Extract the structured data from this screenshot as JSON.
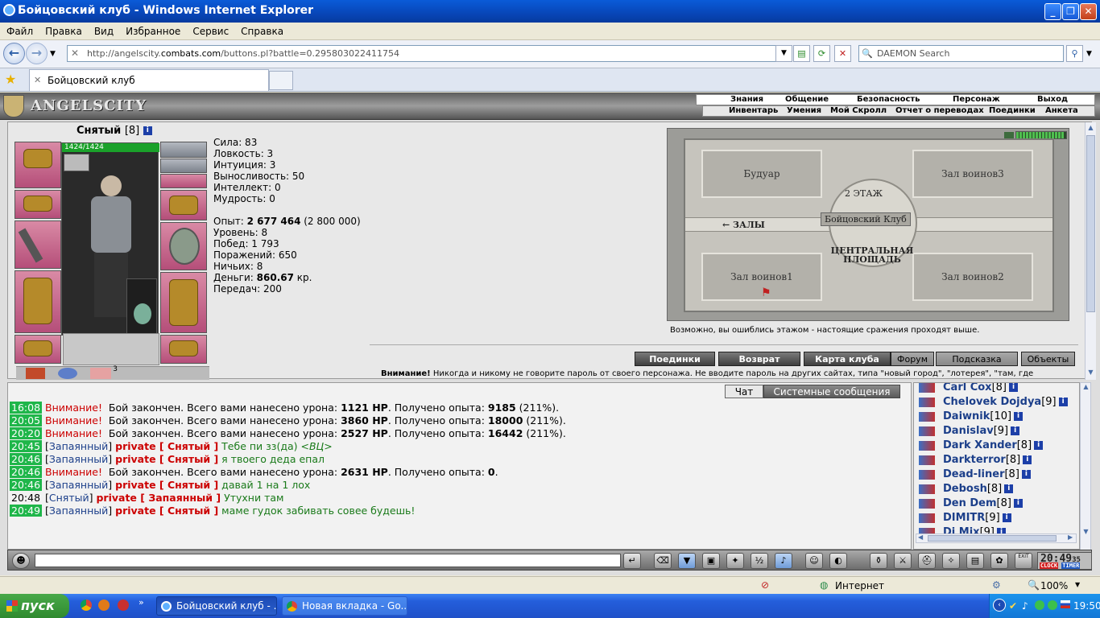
{
  "window": {
    "title": "Бойцовский клуб - Windows Internet Explorer"
  },
  "menu": [
    "Файл",
    "Правка",
    "Вид",
    "Избранное",
    "Сервис",
    "Справка"
  ],
  "address": {
    "url_prefix": "http://angelscity.",
    "url_site": "combats.com",
    "url_suffix": "/buttons.pl?battle=0.295803022411754",
    "search_placeholder": "DAEMON Search"
  },
  "tab": {
    "title": "Бойцовский клуб"
  },
  "game": {
    "logo": "ANGELSCITY",
    "top_menu": [
      "Знания",
      "Общение",
      "Безопасность",
      "Персонаж",
      "Выход"
    ],
    "sub_menu": [
      "Инвентарь",
      "Умения",
      "Мой Скролл",
      "Отчет о переводах",
      "Поединки",
      "Анкета"
    ],
    "character": {
      "name": "Снятый",
      "level": "[8]",
      "hp": "1424/1424",
      "pet_count": "3"
    },
    "stats": {
      "strength": "Сила: 83",
      "agility": "Ловкость: 3",
      "intuition": "Интуиция: 3",
      "endurance": "Выносливость: 50",
      "intellect": "Интеллект: 0",
      "wisdom": "Мудрость: 0",
      "exp_label": "Опыт: ",
      "exp_value": "2 677 464",
      "exp_next": " (2 800 000)",
      "level": "Уровень: 8",
      "wins": "Побед: 1 793",
      "losses": "Поражений: 650",
      "draws": "Ничьих: 8",
      "money_label": "Деньги: ",
      "money_value": "860.67",
      "money_unit": " кр.",
      "transfers": "Передач: 200"
    },
    "map": {
      "room_tl": "Будуар",
      "room_tr": "Зал воинов3",
      "room_bl": "Зал воинов1",
      "room_br": "Зал воинов2",
      "floor": "2 ЭТАЖ",
      "center": "Бойцовский Клуб",
      "halls": "← ЗАЛЫ",
      "plaza": "ЦЕНТРАЛЬНАЯ ПЛОЩАДЬ"
    },
    "map_note": "Возможно, вы ошиблись этажом - настоящие сражения проходят выше.",
    "nav_buttons": [
      "Поединки",
      "Возврат",
      "Карта клуба",
      "Форум",
      "Подсказка",
      "Объекты"
    ],
    "warning_bold": "Внимание!",
    "warning_text": " Никогда и никому не говорите пароль от своего персонажа. Не вводите пароль на других сайтах, типа \"новый город\", \"лотерея\", \"там, где",
    "chat_tabs": [
      "Чат",
      "Системные сообщения"
    ],
    "messages": [
      {
        "time": "16:08",
        "parts": [
          [
            "wn",
            "Внимание!"
          ],
          [
            "",
            "  Бой закончен. Всего вами нанесено урона: "
          ],
          [
            "b",
            "1121 HP"
          ],
          [
            "",
            ". Получено опыта: "
          ],
          [
            "b",
            "9185"
          ],
          [
            "",
            " (211%)."
          ]
        ]
      },
      {
        "time": "20:05",
        "parts": [
          [
            "wn",
            "Внимание!"
          ],
          [
            "",
            "  Бой закончен. Всего вами нанесено урона: "
          ],
          [
            "b",
            "3860 HP"
          ],
          [
            "",
            ". Получено опыта: "
          ],
          [
            "b",
            "18000"
          ],
          [
            "",
            " (211%)."
          ]
        ]
      },
      {
        "time": "20:20",
        "parts": [
          [
            "wn",
            "Внимание!"
          ],
          [
            "",
            "  Бой закончен. Всего вами нанесено урона: "
          ],
          [
            "b",
            "2527 HP"
          ],
          [
            "",
            ". Получено опыта: "
          ],
          [
            "b",
            "16442"
          ],
          [
            "",
            " (211%)."
          ]
        ]
      },
      {
        "time": "20:45",
        "parts": [
          [
            "",
            "["
          ],
          [
            "nick",
            "Запаянный"
          ],
          [
            "",
            "] "
          ],
          [
            "priv",
            "private [ Снятый ]"
          ],
          [
            "txt",
            " Тебе пи зз(да) "
          ],
          [
            "txti",
            "<ВЦ>"
          ]
        ]
      },
      {
        "time": "20:46",
        "parts": [
          [
            "",
            "["
          ],
          [
            "nick",
            "Запаянный"
          ],
          [
            "",
            "] "
          ],
          [
            "priv",
            "private [ Снятый ]"
          ],
          [
            "txt",
            " я твоего деда епал"
          ]
        ]
      },
      {
        "time": "20:46",
        "parts": [
          [
            "wn",
            "Внимание!"
          ],
          [
            "",
            "  Бой закончен. Всего вами нанесено урона: "
          ],
          [
            "b",
            "2631 HP"
          ],
          [
            "",
            ". Получено опыта: "
          ],
          [
            "b",
            "0"
          ],
          [
            "",
            "."
          ]
        ]
      },
      {
        "time": "20:46",
        "parts": [
          [
            "",
            "["
          ],
          [
            "nick",
            "Запаянный"
          ],
          [
            "",
            "] "
          ],
          [
            "priv",
            "private [ Снятый ]"
          ],
          [
            "txt",
            " давай 1 на 1 лох"
          ]
        ]
      },
      {
        "time": "20:48",
        "plain": true,
        "parts": [
          [
            "",
            "["
          ],
          [
            "nick",
            "Снятый"
          ],
          [
            "",
            "] "
          ],
          [
            "priv",
            "private [ Запаянный ]"
          ],
          [
            "txt",
            " Утухни там"
          ]
        ]
      },
      {
        "time": "20:49",
        "parts": [
          [
            "",
            "["
          ],
          [
            "nick",
            "Запаянный"
          ],
          [
            "",
            "] "
          ],
          [
            "priv",
            "private [ Снятый ]"
          ],
          [
            "txt",
            " маме гудок забивать совее будешь!"
          ]
        ]
      }
    ],
    "online": [
      {
        "name": "Carl Cox",
        "level": "[8]"
      },
      {
        "name": "Chelovek Dojdya",
        "level": "[9]"
      },
      {
        "name": "Daiwnik",
        "level": "[10]"
      },
      {
        "name": "Danislav",
        "level": "[9]"
      },
      {
        "name": "Dark Xander",
        "level": "[8]"
      },
      {
        "name": "Darkterror",
        "level": "[8]"
      },
      {
        "name": "Dead-liner",
        "level": "[8]"
      },
      {
        "name": "Debosh",
        "level": "[8]"
      },
      {
        "name": "Den Dem",
        "level": "[8]"
      },
      {
        "name": "DIMITR",
        "level": "[9]"
      },
      {
        "name": "Dj Mix",
        "level": "[9]"
      }
    ],
    "clock": {
      "time": "20:49",
      "sec": "35",
      "clock_label": "CLOCK",
      "timer_label": "TIMER",
      "exit_label": "EXIT"
    }
  },
  "status": {
    "zone": "Интернет",
    "zoom": "100%"
  },
  "taskbar": {
    "start": "пуск",
    "tasks": [
      "Бойцовский клуб - ...",
      "Новая вкладка - Go..."
    ],
    "time": "19:50"
  }
}
